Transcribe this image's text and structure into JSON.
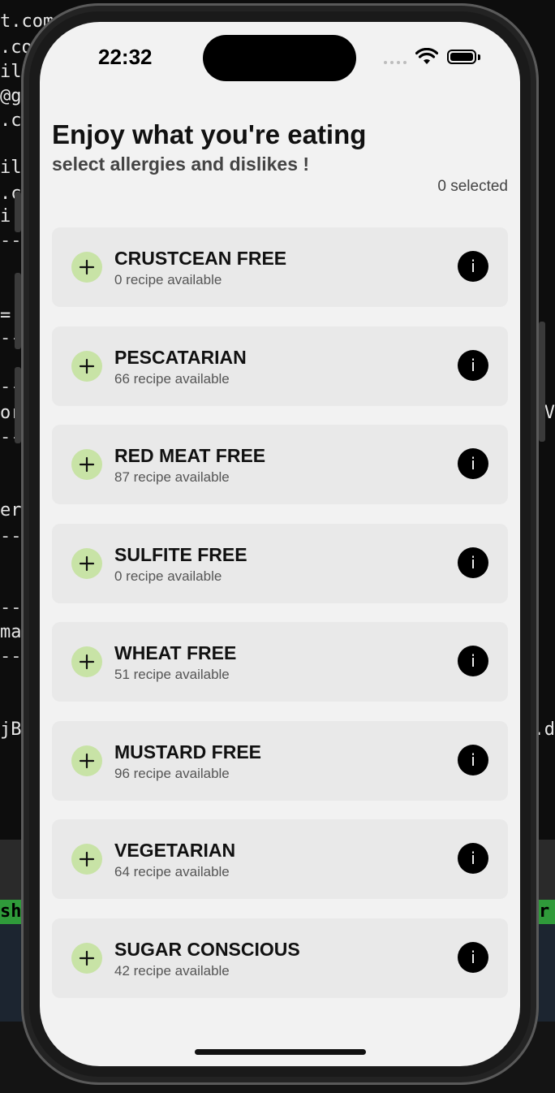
{
  "background_terminal": {
    "lines": [
      "t.com",
      ".co",
      "il",
      "@g",
      ".c",
      "il",
      ".c",
      "i",
      "--",
      "=",
      "--",
      "--",
      "or",
      "--",
      "er",
      "--",
      "--",
      "ma",
      "--",
      "jB"
    ],
    "right_fragments": [
      "V",
      ".d"
    ],
    "status_left": "sh",
    "status_right": "r"
  },
  "status_bar": {
    "time": "22:32"
  },
  "header": {
    "title": "Enjoy what you're eating",
    "subtitle": "select allergies and dislikes !",
    "selected_count": "0 selected"
  },
  "items": [
    {
      "label": "CRUSTCEAN FREE",
      "sub": "0 recipe available"
    },
    {
      "label": "PESCATARIAN",
      "sub": "66 recipe available"
    },
    {
      "label": "RED MEAT FREE",
      "sub": "87 recipe available"
    },
    {
      "label": "SULFITE FREE",
      "sub": "0 recipe available"
    },
    {
      "label": "WHEAT FREE",
      "sub": "51 recipe available"
    },
    {
      "label": "MUSTARD FREE",
      "sub": "96 recipe available"
    },
    {
      "label": "VEGETARIAN",
      "sub": "64 recipe available"
    },
    {
      "label": "SUGAR CONSCIOUS",
      "sub": "42 recipe available"
    }
  ],
  "icons": {
    "add": "plus-icon",
    "info": "info-icon",
    "info_glyph": "i"
  },
  "colors": {
    "add_bg": "#c8e3a6",
    "card_bg": "#e9e9e9",
    "info_bg": "#000000"
  }
}
